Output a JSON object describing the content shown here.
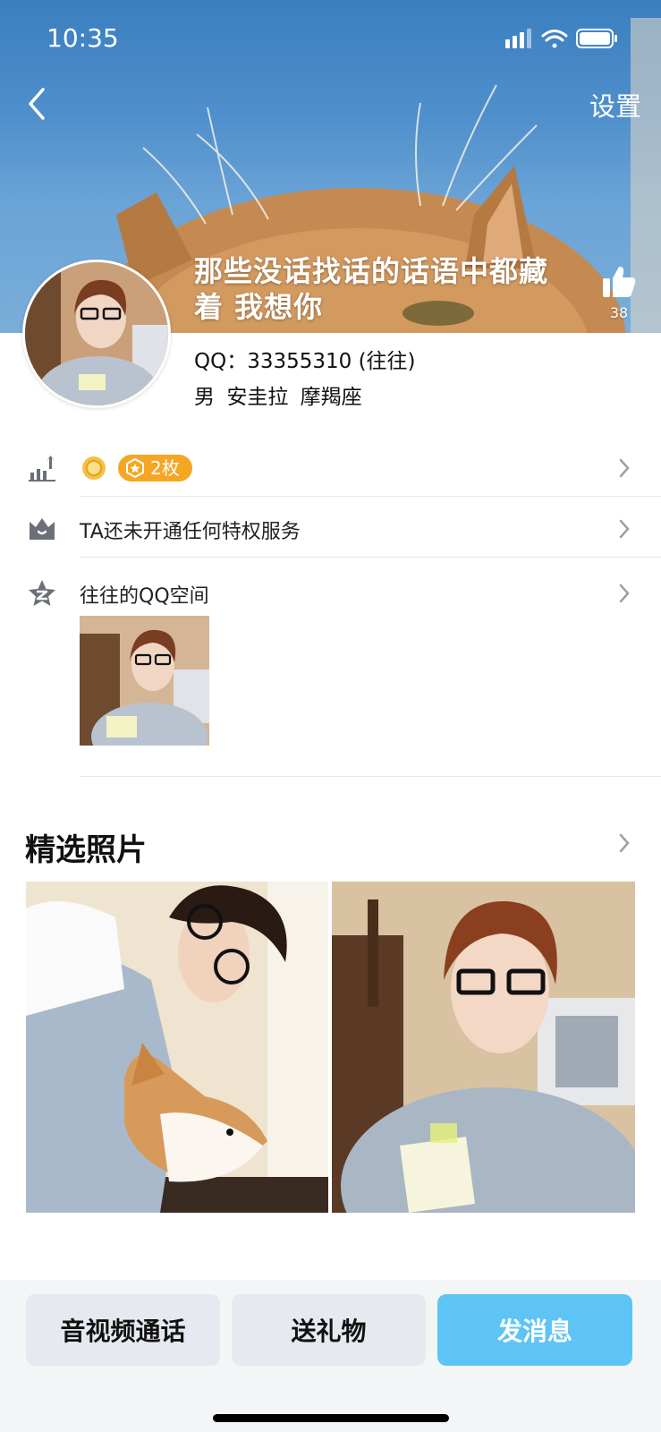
{
  "status_bar": {
    "time": "10:35"
  },
  "header": {
    "settings_label": "设置",
    "signature": "那些没话找话的话语中都藏着 我想你",
    "like_count": "38"
  },
  "profile": {
    "qq_line": "QQ：33355310 (往往)",
    "gender": "男",
    "location": "安圭拉",
    "zodiac": "摩羯座"
  },
  "rows": {
    "medal_count": "2枚",
    "privilege_text": "TA还未开通任何特权服务",
    "qzone_text": "往往的QQ空间"
  },
  "photos": {
    "section_title": "精选照片"
  },
  "actions": {
    "call_label": "音视频通话",
    "gift_label": "送礼物",
    "message_label": "发消息"
  },
  "colors": {
    "accent_blue": "#5ec4f5",
    "medal_orange": "#f5a623",
    "sky": "#4f8fcc"
  }
}
